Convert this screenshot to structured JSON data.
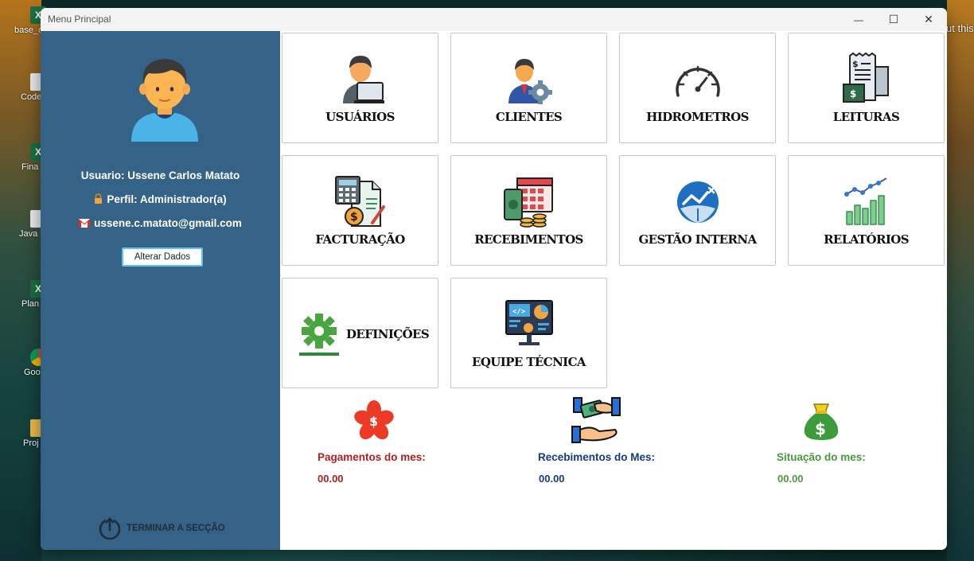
{
  "window": {
    "title": "Menu Principal",
    "minimize": "—",
    "maximize": "☐",
    "close": "✕"
  },
  "desktop": {
    "icons": [
      "base_c",
      "Code",
      "Fina",
      "Java",
      "Plan",
      "Goo",
      "Proj"
    ],
    "peek_text": "ut this"
  },
  "user": {
    "name_line": "Usuario: Ussene Carlos Matato",
    "profile_line": "Perfil: Administrador(a)",
    "email": "ussene.c.matato@gmail.com",
    "alter_button": "Alterar Dados",
    "logout": "TERMINAR A SECÇÃO"
  },
  "tiles": [
    {
      "label": "USUÁRIOS",
      "icon": "user-laptop-icon"
    },
    {
      "label": "CLIENTES",
      "icon": "client-gear-icon"
    },
    {
      "label": "HIDROMETROS",
      "icon": "gauge-icon"
    },
    {
      "label": "LEITURAS",
      "icon": "receipt-icon"
    },
    {
      "label": "FACTURAÇÃO",
      "icon": "calculator-invoice-icon"
    },
    {
      "label": "RECEBIMENTOS",
      "icon": "calendar-money-icon"
    },
    {
      "label": "GESTÃO INTERNA",
      "icon": "chart-circle-icon"
    },
    {
      "label": "RELATÓRIOS",
      "icon": "bar-chart-icon"
    },
    {
      "label": "DEFINIÇÕES",
      "icon": "gear-icon"
    },
    {
      "label": "EQUIPE TÉCNICA",
      "icon": "monitor-code-icon"
    }
  ],
  "summary": {
    "payments": {
      "label": "Pagamentos do mes:",
      "value": "00.00",
      "color": "#b21f1f"
    },
    "receipts": {
      "label": "Recebimentos do Mes:",
      "value": "00.00",
      "color": "#163a86"
    },
    "situation": {
      "label": "Situação do mes:",
      "value": "00.00",
      "color": "#4a9a3d"
    }
  },
  "colors": {
    "sidebar": "#356387",
    "button_border": "#5ec4f3"
  }
}
